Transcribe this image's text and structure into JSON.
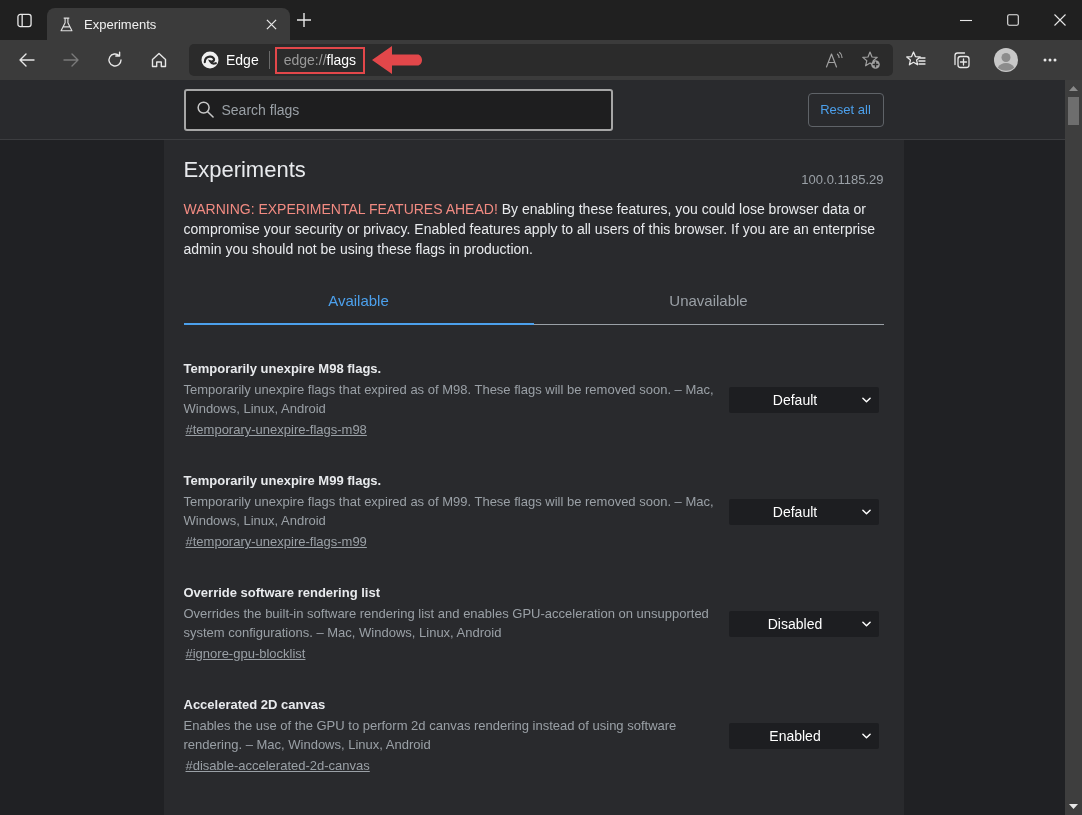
{
  "window": {
    "tab": {
      "title": "Experiments",
      "selected": true
    }
  },
  "toolbar": {
    "nav_buttons": [
      {
        "kind": "back",
        "disabled": false
      },
      {
        "kind": "forward",
        "disabled": true
      },
      {
        "kind": "refresh",
        "disabled": false
      },
      {
        "kind": "home",
        "disabled": false
      }
    ],
    "address_bar": {
      "site_label": "Edge",
      "url_scheme": "edge://",
      "url_path": "flags"
    }
  },
  "header": {
    "search": {
      "placeholder": "Search flags"
    },
    "reset_button": "Reset all"
  },
  "page": {
    "title": "Experiments",
    "version": "100.0.1185.29",
    "warning": {
      "label": "WARNING: EXPERIMENTAL FEATURES AHEAD!",
      "text": "By enabling these features, you could lose browser data or compromise your security or privacy. Enabled features apply to all users of this browser. If you are an enterprise admin you should not be using these flags in production."
    },
    "tabs": [
      {
        "label": "Available",
        "selected": true
      },
      {
        "label": "Unavailable",
        "selected": false
      }
    ],
    "flags": [
      {
        "name": "Temporarily unexpire M98 flags.",
        "description": "Temporarily unexpire flags that expired as of M98. These flags will be removed soon. – Mac, Windows, Linux, Android",
        "link": "#temporary-unexpire-flags-m98",
        "value": "Default"
      },
      {
        "name": "Temporarily unexpire M99 flags.",
        "description": "Temporarily unexpire flags that expired as of M99. These flags will be removed soon. – Mac, Windows, Linux, Android",
        "link": "#temporary-unexpire-flags-m99",
        "value": "Default"
      },
      {
        "name": "Override software rendering list",
        "description": "Overrides the built-in software rendering list and enables GPU-acceleration on unsupported system configurations. – Mac, Windows, Linux, Android",
        "link": "#ignore-gpu-blocklist",
        "value": "Disabled"
      },
      {
        "name": "Accelerated 2D canvas",
        "description": "Enables the use of the GPU to perform 2d canvas rendering instead of using software rendering. – Mac, Windows, Linux, Android",
        "link": "#disable-accelerated-2d-canvas",
        "value": "Enabled"
      }
    ]
  }
}
